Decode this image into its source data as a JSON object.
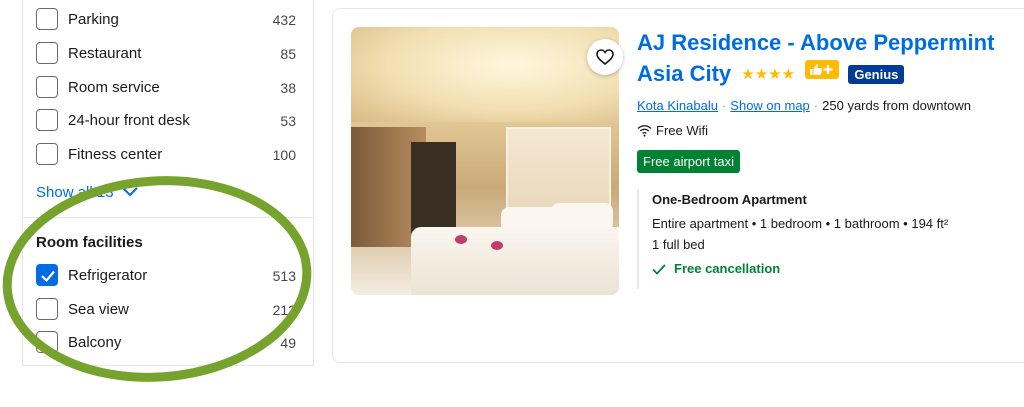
{
  "filters": {
    "facilities": [
      {
        "label": "Parking",
        "count": "432"
      },
      {
        "label": "Restaurant",
        "count": "85"
      },
      {
        "label": "Room service",
        "count": "38"
      },
      {
        "label": "24-hour front desk",
        "count": "53"
      },
      {
        "label": "Fitness center",
        "count": "100"
      }
    ],
    "show_all_label": "Show all 13",
    "room_facilities_title": "Room facilities",
    "room_facilities": [
      {
        "label": "Refrigerator",
        "count": "513",
        "checked": true
      },
      {
        "label": "Sea view",
        "count": "212",
        "checked": false
      },
      {
        "label": "Balcony",
        "count": "49",
        "checked": false
      }
    ]
  },
  "property": {
    "name": "AJ Residence - Above Peppermint Asia City",
    "stars": "★★★★",
    "genius_label": "Genius",
    "city": "Kota Kinabalu",
    "show_on_map": "Show on map",
    "distance": "250 yards from downtown",
    "wifi": "Free Wifi",
    "taxi_badge": "Free airport taxi",
    "room": {
      "name": "One-Bedroom Apartment",
      "details": "Entire apartment • 1 bedroom • 1 bathroom • 194 ft²",
      "beds": "1 full bed",
      "cancellation": "Free cancellation"
    }
  },
  "colors": {
    "link_blue": "#006ce4",
    "genius_navy": "#003b95",
    "star_yellow": "#febb02",
    "success_green": "#008234",
    "annotation_green": "#76a32d"
  },
  "icons": [
    "checkbox-check-icon",
    "chevron-down-icon",
    "heart-icon",
    "thumbs-up-icon",
    "wifi-icon",
    "check-icon"
  ]
}
